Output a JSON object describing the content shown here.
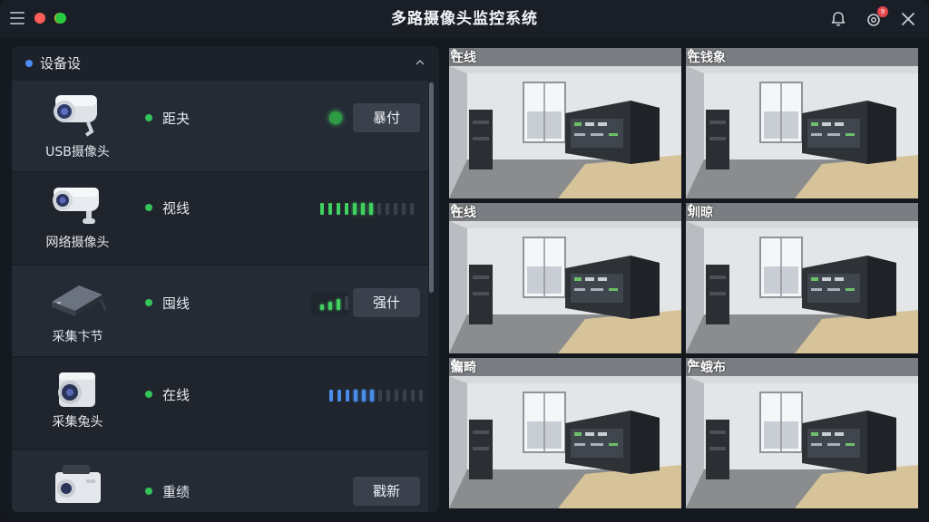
{
  "window": {
    "title": "多路摄像头监控系统",
    "traffic_lights": [
      "#ff5f57",
      "#febc2e",
      "#28c840"
    ],
    "notification_badge": "9"
  },
  "panel": {
    "title": "设备设",
    "accent": "#4d8cf5"
  },
  "devices": [
    {
      "name": "USB摄像头",
      "status": "距夬",
      "action": "暴付",
      "indicator": "led"
    },
    {
      "name": "网络摄像头",
      "status": "视线",
      "indicator": "signal-green",
      "level": 0.6
    },
    {
      "name": "采集卞节",
      "status": "囤线",
      "action": "强什",
      "indicator": "signal-small",
      "level": 0.75
    },
    {
      "name": "采集兔头",
      "status": "在线",
      "indicator": "signal-blue",
      "level": 0.5
    },
    {
      "name": "",
      "status": "重绩",
      "action": "戳新",
      "indicator": "none"
    }
  ],
  "cameras": [
    {
      "label": "在线"
    },
    {
      "label": "在钱象"
    },
    {
      "label": "在线"
    },
    {
      "label": "圳晾"
    },
    {
      "label": "瘺畸"
    },
    {
      "label": "产蛾布"
    }
  ],
  "colors": {
    "online": "#33c45a",
    "signal_green": "#3fd060",
    "signal_blue": "#4a8de8",
    "badge": "#e5484d"
  }
}
